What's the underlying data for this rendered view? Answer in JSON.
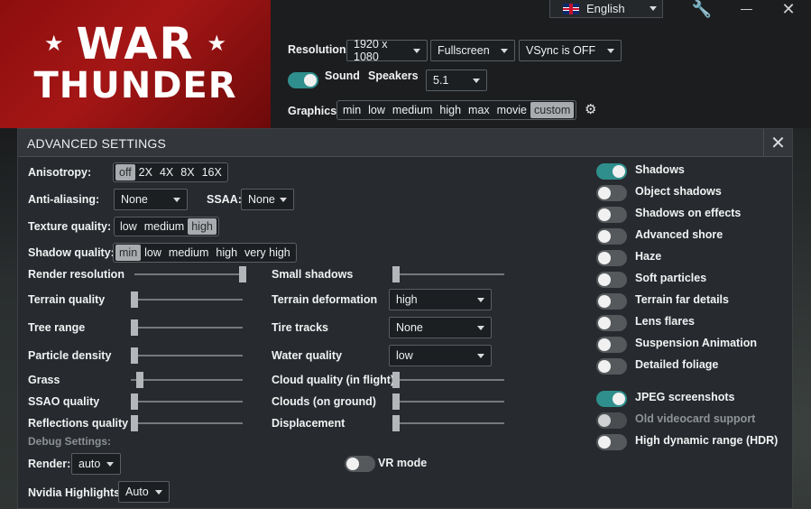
{
  "logo": {
    "line1": "WAR",
    "line2": "THUNDER",
    "star": "★"
  },
  "language": {
    "value": "English",
    "flag": "uk-flag-icon"
  },
  "window": {
    "wrench": "🔧",
    "close": "✕"
  },
  "top": {
    "resolution_label": "Resolution",
    "resolution": "1920 x 1080",
    "mode": "Fullscreen",
    "vsync": "VSync is OFF",
    "sound_label": "Sound",
    "speakers_label": "Speakers",
    "speakers": "5.1",
    "graphics_label": "Graphics:",
    "graphics_presets": [
      "min",
      "low",
      "medium",
      "high",
      "max",
      "movie",
      "custom"
    ],
    "graphics_selected": "custom"
  },
  "dialog": {
    "title": "ADVANCED SETTINGS",
    "close": "✕",
    "anisotropy_label": "Anisotropy:",
    "anisotropy_options": [
      "off",
      "2X",
      "4X",
      "8X",
      "16X"
    ],
    "anisotropy_selected": "off",
    "antialiasing_label": "Anti-aliasing:",
    "antialiasing": "None",
    "ssaa_label": "SSAA:",
    "ssaa": "None",
    "texture_label": "Texture quality:",
    "texture_options": [
      "low",
      "medium",
      "high"
    ],
    "texture_selected": "high",
    "shadowq_label": "Shadow quality:",
    "shadowq_options": [
      "min",
      "low",
      "medium",
      "high",
      "very high"
    ],
    "shadowq_selected": "min",
    "sliders_left": [
      {
        "label": "Render resolution",
        "level": 1.0
      },
      {
        "label": "Terrain quality",
        "level": 0.0
      },
      {
        "label": "Tree range",
        "level": 0.0
      },
      {
        "label": "Particle density",
        "level": 0.0
      },
      {
        "label": "Grass",
        "level": 0.05
      },
      {
        "label": "SSAO quality",
        "level": 0.0
      },
      {
        "label": "Reflections quality",
        "level": 0.0
      }
    ],
    "small_shadows_label": "Small shadows",
    "small_shadows_level": 0.0,
    "terrain_deformation_label": "Terrain deformation",
    "terrain_deformation": "high",
    "tire_tracks_label": "Tire tracks",
    "tire_tracks": "None",
    "water_quality_label": "Water quality",
    "water_quality": "low",
    "cloud_flight_label": "Cloud quality (in flight)",
    "cloud_flight_level": 0.0,
    "clouds_ground_label": "Clouds (on ground)",
    "clouds_ground_level": 0.0,
    "displacement_label": "Displacement",
    "displacement_level": 0.0,
    "debug_label": "Debug Settings:",
    "render_label": "Render:",
    "render": "auto",
    "vr_label": "VR mode",
    "vr_on": false,
    "nvidia_label": "Nvidia Highlights:",
    "nvidia": "Auto",
    "toggles": [
      {
        "label": "Shadows",
        "on": true
      },
      {
        "label": "Object shadows",
        "on": false
      },
      {
        "label": "Shadows on effects",
        "on": false
      },
      {
        "label": "Advanced shore",
        "on": false
      },
      {
        "label": "Haze",
        "on": false
      },
      {
        "label": "Soft particles",
        "on": false
      },
      {
        "label": "Terrain far details",
        "on": false
      },
      {
        "label": "Lens flares",
        "on": false
      },
      {
        "label": "Suspension Animation",
        "on": false
      },
      {
        "label": "Detailed foliage",
        "on": false
      },
      {
        "label": "JPEG screenshots",
        "on": true
      },
      {
        "label": "Old videocard support",
        "on": false,
        "disabled": true
      },
      {
        "label": "High dynamic range (HDR)",
        "on": false
      }
    ]
  },
  "colors": {
    "accent": "#2f8f8c",
    "brand_red": "#a51616",
    "panel": "#272a2e"
  }
}
